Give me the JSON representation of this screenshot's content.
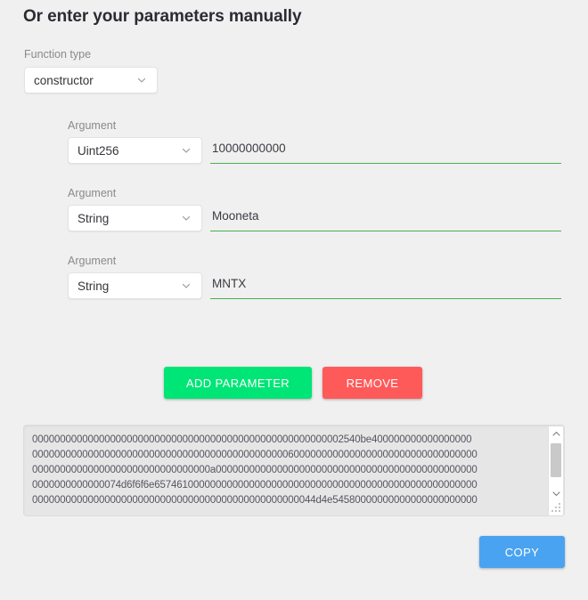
{
  "header": {
    "title": "Or enter your parameters manually"
  },
  "function_type": {
    "label": "Function type",
    "value": "constructor",
    "chevron_icon": "chevron-down-icon"
  },
  "arguments": [
    {
      "label": "Argument",
      "type": "Uint256",
      "value": "10000000000",
      "placeholder": "",
      "underline_color": "#4caf50"
    },
    {
      "label": "Argument",
      "type": "String",
      "value": "Mooneta",
      "placeholder": "",
      "underline_color": "#4caf50"
    },
    {
      "label": "Argument",
      "type": "String",
      "value": "MNTX",
      "placeholder": "",
      "underline_color": "#4caf50"
    }
  ],
  "buttons": {
    "add_parameter": "ADD PARAMETER",
    "remove": "REMOVE",
    "copy": "COPY",
    "add_color": "#00e676",
    "remove_color": "#ff5a5a",
    "copy_color": "#4aa3f0"
  },
  "output": {
    "encoded_lines": [
      "00000000000000000000000000000000000000000000000000000002540be400000000000000000",
      "00000000000000000000000000000000000000000000006000000000000000000000000000000000",
      "00000000000000000000000000000000a00000000000000000000000000000000000000000000000",
      "0000000000000074d6f6f6e6574610000000000000000000000000000000000000000000000000000",
      "000000000000000000000000000000000000000000000000044d4e54580000000000000000000000"
    ],
    "scrollbar": {
      "up_icon": "chevron-up-icon",
      "down_icon": "chevron-down-icon"
    },
    "resize_grip_icon": "resize-grip-icon"
  }
}
